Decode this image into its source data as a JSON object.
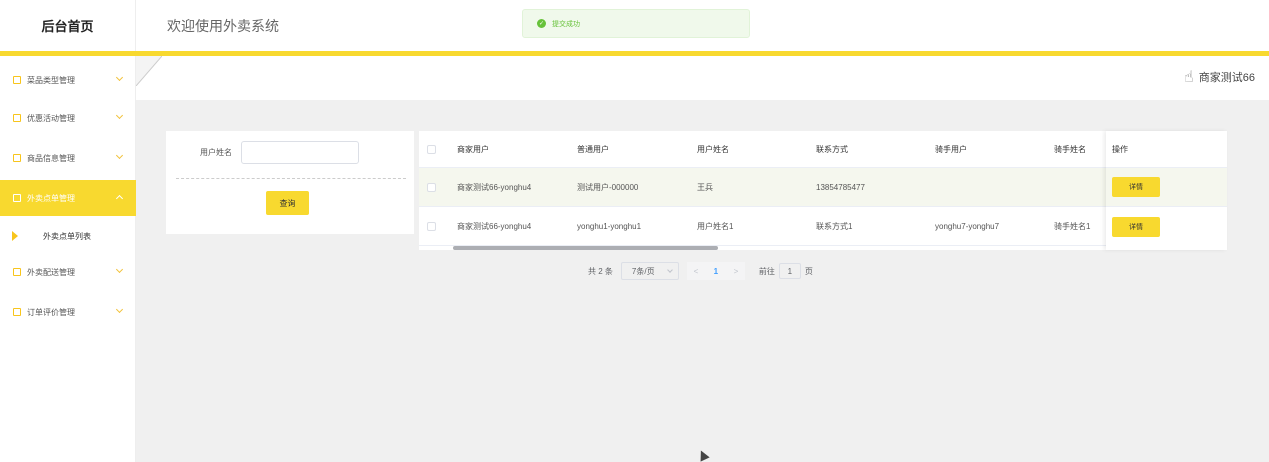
{
  "header": {
    "home_label": "后台首页",
    "welcome": "欢迎使用外卖系统",
    "accent_color": "#f8d92f"
  },
  "toast": {
    "message": "提交成功",
    "icon": "check-circle-icon",
    "color": "#67c23a"
  },
  "user": {
    "name": "商家测试66",
    "icon": "hand-icon"
  },
  "sidebar": {
    "items": [
      {
        "label": "菜品类型管理",
        "active": false
      },
      {
        "label": "优惠活动管理",
        "active": false
      },
      {
        "label": "商品信息管理",
        "active": false
      },
      {
        "label": "外卖点单管理",
        "active": true
      },
      {
        "label": "外卖配送管理",
        "active": false
      },
      {
        "label": "订单评价管理",
        "active": false
      }
    ],
    "sub_item": "外卖点单列表"
  },
  "search": {
    "label": "用户姓名",
    "value": "",
    "placeholder": "",
    "button": "查询"
  },
  "table": {
    "headers": [
      "商家用户",
      "普通用户",
      "用户姓名",
      "联系方式",
      "骑手用户",
      "骑手姓名",
      "操作"
    ],
    "rows": [
      {
        "merchant": "商家测试66-yonghu4",
        "user": "测试用户-000000",
        "name": "王兵",
        "phone": "13854785477",
        "rider": "",
        "rider_name": "",
        "action": "详情"
      },
      {
        "merchant": "商家测试66-yonghu4",
        "user": "yonghu1-yonghu1",
        "name": "用户姓名1",
        "phone": "联系方式1",
        "rider": "yonghu7-yonghu7",
        "rider_name": "骑手姓名1",
        "action": "详情"
      }
    ]
  },
  "pagination": {
    "total": "共 2 条",
    "page_size": "7条/页",
    "prev": "<",
    "current": "1",
    "next": ">",
    "goto_label": "前往",
    "goto_value": "1",
    "page_unit": "页"
  }
}
